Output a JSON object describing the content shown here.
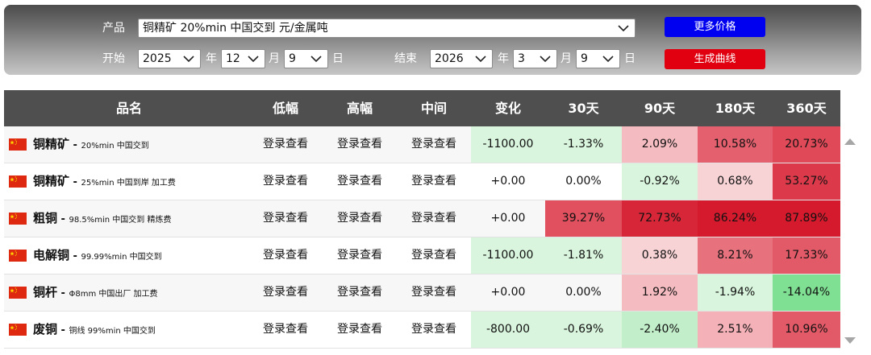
{
  "filter": {
    "product_label": "产品",
    "product_value": "铜精矿 20%min 中国交到 元/金属吨",
    "more_prices_button": "更多价格",
    "start_label": "开始",
    "start_year": "2025",
    "start_month": "12",
    "start_day": "9",
    "end_label": "结束",
    "end_year": "2026",
    "end_month": "3",
    "end_day": "9",
    "year_unit": "年",
    "month_unit": "月",
    "day_unit": "日",
    "generate_button": "生成曲线",
    "more_prices_color": "#0000f0",
    "generate_color": "#e00010"
  },
  "table": {
    "headers": [
      "品名",
      "低幅",
      "高幅",
      "中间",
      "变化",
      "30天",
      "90天",
      "180天",
      "360天"
    ],
    "login_text": "登录查看",
    "rows": [
      {
        "name": "铜精矿",
        "desc": "20%min 中国交到",
        "low": "登录查看",
        "high": "登录查看",
        "mid": "登录查看",
        "change": "-1100.00",
        "d30": "-1.33%",
        "d90": "2.09%",
        "d180": "10.58%",
        "d360": "20.73%",
        "c_change": "#d9f5dd",
        "c30": "#d9f5dd",
        "c90": "#f4bcc1",
        "c180": "#e4606e",
        "c360": "#e04a58"
      },
      {
        "name": "铜精矿",
        "desc": "25%min 中国到岸 加工费",
        "low": "登录查看",
        "high": "登录查看",
        "mid": "登录查看",
        "change": "+0.00",
        "d30": "0.00%",
        "d90": "-0.92%",
        "d180": "0.68%",
        "d360": "53.27%",
        "c_change": "#ffffff",
        "c30": "#ffffff",
        "c90": "#d9f5dd",
        "c180": "#f8d3d6",
        "c360": "#dc3a4a"
      },
      {
        "name": "粗铜",
        "desc": "98.5%min 中国交到 精炼费",
        "low": "登录查看",
        "high": "登录查看",
        "mid": "登录查看",
        "change": "+0.00",
        "d30": "39.27%",
        "d90": "72.73%",
        "d180": "86.24%",
        "d360": "87.89%",
        "c_change": "#f7f7f7",
        "c30": "#e1505e",
        "c90": "#d62637",
        "c180": "#d41a2c",
        "c360": "#d41a2c"
      },
      {
        "name": "电解铜",
        "desc": "99.99%min 中国交到",
        "low": "登录查看",
        "high": "登录查看",
        "mid": "登录查看",
        "change": "-1100.00",
        "d30": "-1.81%",
        "d90": "0.38%",
        "d180": "8.21%",
        "d360": "17.33%",
        "c_change": "#d9f5dd",
        "c30": "#d9f5dd",
        "c90": "#f8d3d6",
        "c180": "#e7727e",
        "c360": "#e25a67"
      },
      {
        "name": "铜杆",
        "desc": "Φ8mm 中国出厂 加工费",
        "low": "登录查看",
        "high": "登录查看",
        "mid": "登录查看",
        "change": "+0.00",
        "d30": "0.00%",
        "d90": "1.92%",
        "d180": "-1.94%",
        "d360": "-14.04%",
        "c_change": "#f7f7f7",
        "c30": "#f7f7f7",
        "c90": "#f4bcc1",
        "c180": "#d9f5dd",
        "c360": "#7fdf92"
      },
      {
        "name": "废铜",
        "desc": "铜线 99%min 中国交到",
        "low": "登录查看",
        "high": "登录查看",
        "mid": "登录查看",
        "change": "-800.00",
        "d30": "-0.69%",
        "d90": "-2.40%",
        "d180": "2.51%",
        "d360": "10.96%",
        "c_change": "#d9f5dd",
        "c30": "#d9f5dd",
        "c90": "#c2efca",
        "c180": "#f4b2b8",
        "c360": "#e25a67"
      }
    ]
  },
  "scrollbar": {
    "up_icon": "arrow-up-icon",
    "down_icon": "arrow-down-icon"
  },
  "flag_icon": "china-flag-icon"
}
